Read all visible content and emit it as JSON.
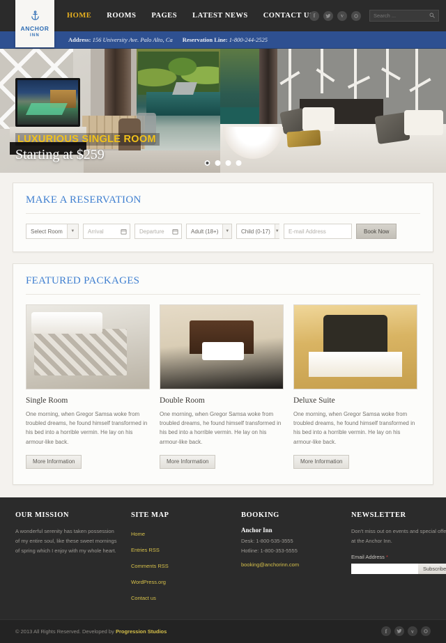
{
  "brand": {
    "anchor_icon": "anchor-icon",
    "name": "ANCHOR",
    "sub": "INN",
    "color": "#2e6db4"
  },
  "nav": {
    "items": [
      {
        "label": "HOME",
        "active": true
      },
      {
        "label": "ROOMS",
        "active": false
      },
      {
        "label": "PAGES",
        "active": false
      },
      {
        "label": "LATEST NEWS",
        "active": false
      },
      {
        "label": "CONTACT US",
        "active": false
      }
    ],
    "active_color": "#e8b120"
  },
  "social": [
    {
      "name": "facebook-icon",
      "glyph": "f"
    },
    {
      "name": "twitter-icon",
      "glyph": "t"
    },
    {
      "name": "vimeo-icon",
      "glyph": "v"
    },
    {
      "name": "google-plus-icon",
      "glyph": "g"
    }
  ],
  "search": {
    "placeholder": "Search ...",
    "value": "",
    "icon": "search-icon"
  },
  "infobar": {
    "address_label": "Address:",
    "address_value": "156 University Ave. Palo Alto, Ca",
    "reservation_label": "Reservation Line:",
    "reservation_value": "1-800-244-2525",
    "background": "#2e5091"
  },
  "hero": {
    "eyebrow": "LUXURIOUS SINGLE ROOM",
    "title": "Starting at $259",
    "eyebrow_color": "#f2c21a",
    "slides_total": 4,
    "active_slide": 1
  },
  "reservation": {
    "title": "MAKE A RESERVATION",
    "room_label": "Select Room",
    "arrival_placeholder": "Arrival",
    "departure_placeholder": "Departure",
    "adult_label": "Adult (18+)",
    "child_label": "Child (0-17)",
    "email_placeholder": "E-mail Address",
    "email_value": "",
    "book_label": "Book Now",
    "calendar_icon": "calendar-icon",
    "caret_icon": "chevron-down-icon"
  },
  "featured": {
    "title": "FEATURED PACKAGES",
    "cards": [
      {
        "title": "Single Room",
        "body": "One morning, when Gregor Samsa woke from troubled dreams, he found himself transformed in his bed into a horrible vermin. He lay on his armour-like back.",
        "button": "More Information",
        "image": "single-room-photo"
      },
      {
        "title": "Double Room",
        "body": "One morning, when Gregor Samsa woke from troubled dreams, he found himself transformed in his bed into a horrible vermin. He lay on his armour-like back.",
        "button": "More Information",
        "image": "double-room-photo"
      },
      {
        "title": "Deluxe Suite",
        "body": "One morning, when Gregor Samsa woke from troubled dreams, he found himself transformed in his bed into a horrible vermin. He lay on his armour-like back.",
        "button": "More Information",
        "image": "deluxe-suite-photo"
      }
    ]
  },
  "footer": {
    "mission": {
      "title": "OUR MISSION",
      "body": "A wonderful serenity has taken possession of my entire soul, like these sweet mornings of spring which I enjoy with my whole heart."
    },
    "sitemap": {
      "title": "SITE MAP",
      "links": [
        "Home",
        "Entries RSS",
        "Comments RSS",
        "WordPress.org",
        "Contact us"
      ]
    },
    "booking": {
      "title": "BOOKING",
      "name": "Anchor Inn",
      "desk": "Desk: 1-800-535-3555",
      "hotline": "Hotline: 1-800-353-5555",
      "email": "booking@anchorinn.com"
    },
    "newsletter": {
      "title": "NEWSLETTER",
      "body": "Don't miss out on events and special offers at the Anchor Inn.",
      "field_label": "Email Address",
      "required_mark": "*",
      "input_value": "",
      "button": "Subscribe"
    }
  },
  "copyright": {
    "text": "© 2013 All Rights Reserved. Developed by ",
    "developer": "Progression Studios"
  }
}
